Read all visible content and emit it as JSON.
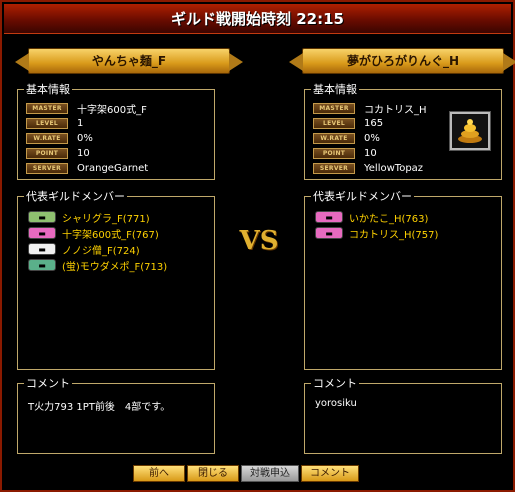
{
  "window": {
    "title": "ギルド戦開始時刻 22:15"
  },
  "left_guild": {
    "name": "やんちゃ麺_F",
    "info_label": "基本情報",
    "stats": [
      {
        "tag": "MASTER",
        "value": "十字架600式_F"
      },
      {
        "tag": "LEVEL",
        "value": "1"
      },
      {
        "tag": "W.RATE",
        "value": "0%"
      },
      {
        "tag": "POINT",
        "value": "10"
      },
      {
        "tag": "SERVER",
        "value": "OrangeGarnet"
      }
    ],
    "members_label": "代表ギルドメンバー",
    "members": [
      {
        "name": "シャリグラ_F(771)",
        "icon": "member-icon-1",
        "color": "#8fc070"
      },
      {
        "name": "十字架600式_F(767)",
        "icon": "member-icon-2",
        "color": "#e86ac0"
      },
      {
        "name": "ノノジ僧_F(724)",
        "icon": "member-icon-3",
        "color": "#f0f0f0"
      },
      {
        "name": "(蛍)モウダメポ_F(713)",
        "icon": "member-icon-4",
        "color": "#5ab08a"
      }
    ],
    "comment_label": "コメント",
    "comment": "T火力793 1PT前後　4部です。"
  },
  "right_guild": {
    "name": "夢がひろがりんぐ_H",
    "info_label": "基本情報",
    "stats": [
      {
        "tag": "MASTER",
        "value": "コカトリス_H"
      },
      {
        "tag": "LEVEL",
        "value": "165"
      },
      {
        "tag": "W.RATE",
        "value": "0%"
      },
      {
        "tag": "POINT",
        "value": "10"
      },
      {
        "tag": "SERVER",
        "value": "YellowTopaz"
      }
    ],
    "emblem_icon": "guild-emblem-icon",
    "members_label": "代表ギルドメンバー",
    "members": [
      {
        "name": "いかたこ_H(763)",
        "icon": "member-icon-5",
        "color": "#e86ac0"
      },
      {
        "name": "コカトリス_H(757)",
        "icon": "member-icon-6",
        "color": "#e86ac0"
      }
    ],
    "comment_label": "コメント",
    "comment": "yorosiku"
  },
  "vs_text": "VS",
  "buttons": {
    "prev": "前へ",
    "close": "閉じる",
    "apply": "対戦申込",
    "comment": "コメント"
  },
  "colors": {
    "title_bar": "#8b1a00",
    "banner": "#e0a830",
    "panel_border": "#bfa86a",
    "member_text": "#ffd200"
  }
}
